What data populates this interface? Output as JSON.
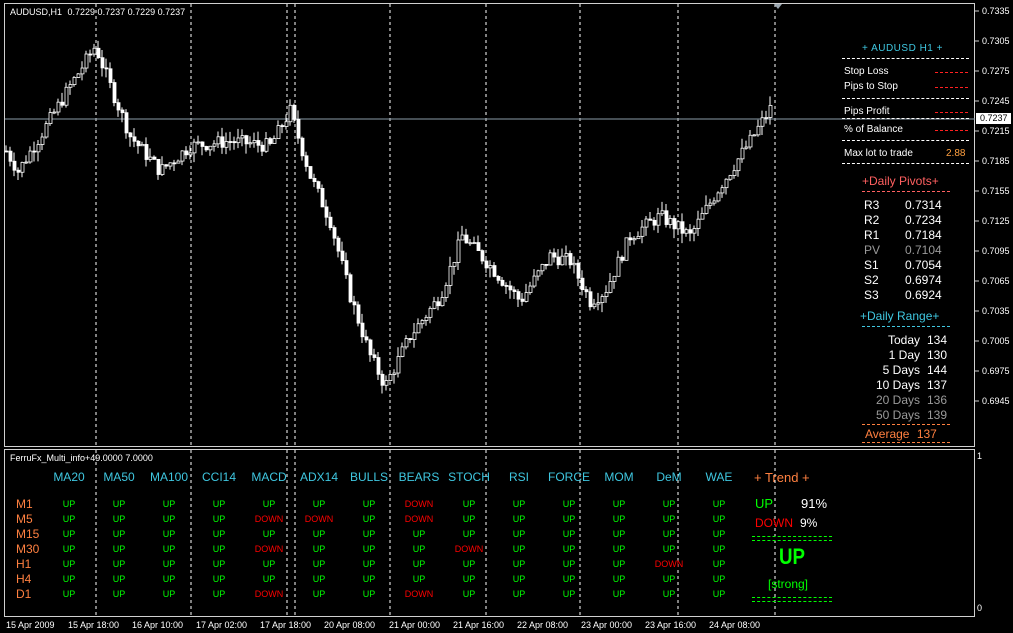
{
  "chart": {
    "symbol_title": "AUDUSD,H1",
    "ohlc_text": "0.7229 0.7237 0.7229 0.7237",
    "current_price": "0.7237",
    "price_axis": [
      "0.7335",
      "0.7305",
      "0.7275",
      "0.7245",
      "0.7215",
      "0.7185",
      "0.7155",
      "0.7125",
      "0.7095",
      "0.7065",
      "0.7035",
      "0.7005",
      "0.6975",
      "0.6945"
    ],
    "time_axis": [
      "15 Apr 2009",
      "15 Apr 18:00",
      "16 Apr 10:00",
      "17 Apr 02:00",
      "17 Apr 18:00",
      "20 Apr 08:00",
      "21 Apr 00:00",
      "21 Apr 16:00",
      "22 Apr 08:00",
      "23 Apr 00:00",
      "23 Apr 16:00",
      "24 Apr 08:00"
    ],
    "colors": {
      "background": "#000000",
      "candles": "#ffffff",
      "grid": "#ffffff",
      "price_line": "#8a9ba8"
    }
  },
  "info_panel": {
    "header": "+ AUDUSD H1 +",
    "stop_loss_label": "Stop Loss",
    "pips_to_stop_label": "Pips to Stop",
    "pips_profit_label": "Pips Profit",
    "balance_label": "% of Balance",
    "max_lot_label": "Max lot to trade",
    "max_lot_value": "2.88"
  },
  "pivots": {
    "header": "+Daily Pivots+",
    "rows": [
      {
        "name": "R3",
        "value": "0.7314"
      },
      {
        "name": "R2",
        "value": "0.7234"
      },
      {
        "name": "R1",
        "value": "0.7184"
      },
      {
        "name": "PV",
        "value": "0.7104"
      },
      {
        "name": "S1",
        "value": "0.7054"
      },
      {
        "name": "S2",
        "value": "0.6974"
      },
      {
        "name": "S3",
        "value": "0.6924"
      }
    ]
  },
  "daily_range": {
    "header": "+Daily Range+",
    "rows": [
      {
        "label": "Today",
        "value": "134"
      },
      {
        "label": "1 Day",
        "value": "130"
      },
      {
        "label": "5 Days",
        "value": "144"
      },
      {
        "label": "10 Days",
        "value": "137"
      },
      {
        "label": "20 Days",
        "value": "136"
      },
      {
        "label": "50 Days",
        "value": "139"
      }
    ],
    "average_label": "Average",
    "average_value": "137"
  },
  "indicator": {
    "title": "FerruFx_Multi_info+",
    "values_text": "49.0000 7.0000",
    "scale_top": "1",
    "scale_bottom": "0",
    "columns": [
      "MA20",
      "MA50",
      "MA100",
      "CCI14",
      "MACD",
      "ADX14",
      "BULLS",
      "BEARS",
      "STOCH",
      "RSI",
      "FORCE",
      "MOM",
      "DeM",
      "WAE"
    ],
    "rows": [
      {
        "tf": "M1",
        "cells": [
          "UP",
          "UP",
          "UP",
          "UP",
          "UP",
          "UP",
          "UP",
          "DOWN",
          "UP",
          "UP",
          "UP",
          "UP",
          "UP",
          "UP"
        ]
      },
      {
        "tf": "M5",
        "cells": [
          "UP",
          "UP",
          "UP",
          "UP",
          "DOWN",
          "DOWN",
          "UP",
          "DOWN",
          "UP",
          "UP",
          "UP",
          "UP",
          "UP",
          "UP"
        ]
      },
      {
        "tf": "M15",
        "cells": [
          "UP",
          "UP",
          "UP",
          "UP",
          "UP",
          "UP",
          "UP",
          "UP",
          "UP",
          "UP",
          "UP",
          "UP",
          "UP",
          "UP"
        ]
      },
      {
        "tf": "M30",
        "cells": [
          "UP",
          "UP",
          "UP",
          "UP",
          "DOWN",
          "UP",
          "UP",
          "UP",
          "DOWN",
          "UP",
          "UP",
          "UP",
          "UP",
          "UP"
        ]
      },
      {
        "tf": "H1",
        "cells": [
          "UP",
          "UP",
          "UP",
          "UP",
          "UP",
          "UP",
          "UP",
          "UP",
          "UP",
          "UP",
          "UP",
          "UP",
          "DOWN",
          "UP"
        ]
      },
      {
        "tf": "H4",
        "cells": [
          "UP",
          "UP",
          "UP",
          "UP",
          "UP",
          "UP",
          "UP",
          "UP",
          "UP",
          "UP",
          "UP",
          "UP",
          "UP",
          "UP"
        ]
      },
      {
        "tf": "D1",
        "cells": [
          "UP",
          "UP",
          "UP",
          "UP",
          "DOWN",
          "UP",
          "UP",
          "DOWN",
          "UP",
          "UP",
          "UP",
          "UP",
          "UP",
          "UP"
        ]
      }
    ],
    "trend": {
      "header": "+ Trend +",
      "up_label": "UP",
      "up_pct": "91%",
      "down_label": "DOWN",
      "down_pct": "9%",
      "signal": "UP",
      "strength": "[strong]"
    }
  }
}
